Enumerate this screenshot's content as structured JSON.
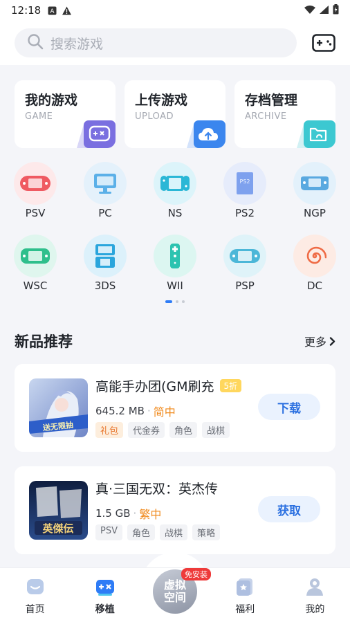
{
  "status": {
    "time": "12:18"
  },
  "search": {
    "placeholder": "搜索游戏"
  },
  "shortcuts": [
    {
      "title": "我的游戏",
      "sub": "GAME"
    },
    {
      "title": "上传游戏",
      "sub": "UPLOAD"
    },
    {
      "title": "存档管理",
      "sub": "ARCHIVE"
    }
  ],
  "platforms": [
    {
      "label": "PSV",
      "icon": "handheld-icon"
    },
    {
      "label": "PC",
      "icon": "monitor-icon"
    },
    {
      "label": "NS",
      "icon": "switch-icon"
    },
    {
      "label": "PS2",
      "icon": "ps2-icon"
    },
    {
      "label": "NGP",
      "icon": "ngp-icon"
    },
    {
      "label": "WSC",
      "icon": "wsc-icon"
    },
    {
      "label": "3DS",
      "icon": "3ds-icon"
    },
    {
      "label": "WII",
      "icon": "wii-remote-icon"
    },
    {
      "label": "PSP",
      "icon": "psp-icon"
    },
    {
      "label": "DC",
      "icon": "dc-swirl-icon"
    }
  ],
  "section": {
    "title": "新品推荐",
    "more": "更多"
  },
  "games": [
    {
      "name": "高能手办团(GM刷充",
      "discount": "5折",
      "size": "645.2 MB",
      "lang": "简中",
      "tags": [
        "礼包",
        "代金券",
        "角色",
        "战棋"
      ],
      "button": "下载",
      "cover_text": "送无限抽"
    },
    {
      "name": "真·三国无双：英杰传",
      "size": "1.5 GB",
      "lang": "繁中",
      "tags": [
        "PSV",
        "角色",
        "战棋",
        "策略"
      ],
      "button": "获取",
      "cover_text": "英傑伝"
    }
  ],
  "tabs": [
    {
      "label": "首页"
    },
    {
      "label": "移植"
    },
    {
      "label": "福利"
    },
    {
      "label": "我的"
    }
  ],
  "center": {
    "label": "虚拟空间",
    "badge": "免安装"
  },
  "colors": {
    "accent": "#2e7cf6",
    "orange": "#f08a1d",
    "discount": "#ffd75e"
  }
}
